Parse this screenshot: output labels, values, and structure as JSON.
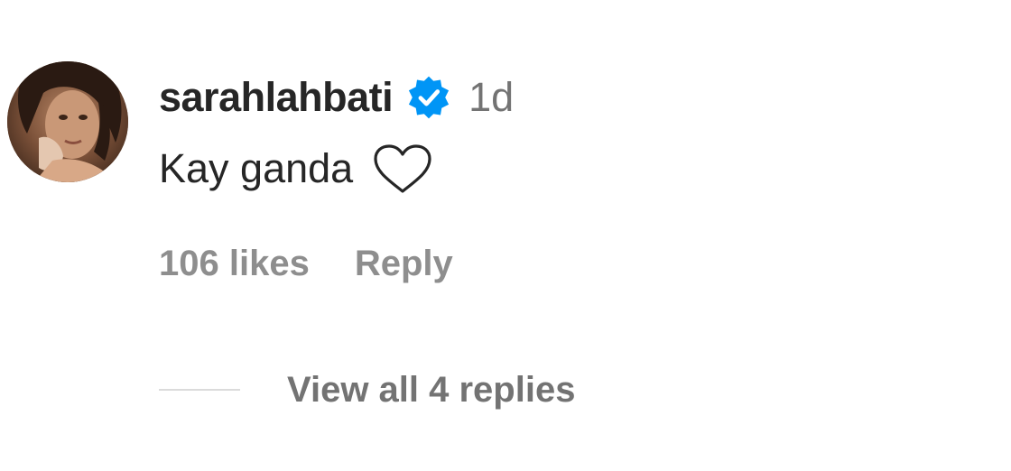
{
  "comment": {
    "username": "sarahlahbati",
    "verified": true,
    "timestamp": "1d",
    "text": "Kay ganda",
    "emoji": "white-heart",
    "likes": "106 likes",
    "reply_label": "Reply",
    "view_replies_label": "View all 4 replies"
  },
  "colors": {
    "primary_text": "#262626",
    "secondary_text": "#737373",
    "verified_blue": "#0095f6",
    "divider": "#dbdbdb"
  },
  "icons": {
    "verified": "verified-badge-icon",
    "emoji": "white-heart-icon",
    "avatar": "profile-photo"
  }
}
